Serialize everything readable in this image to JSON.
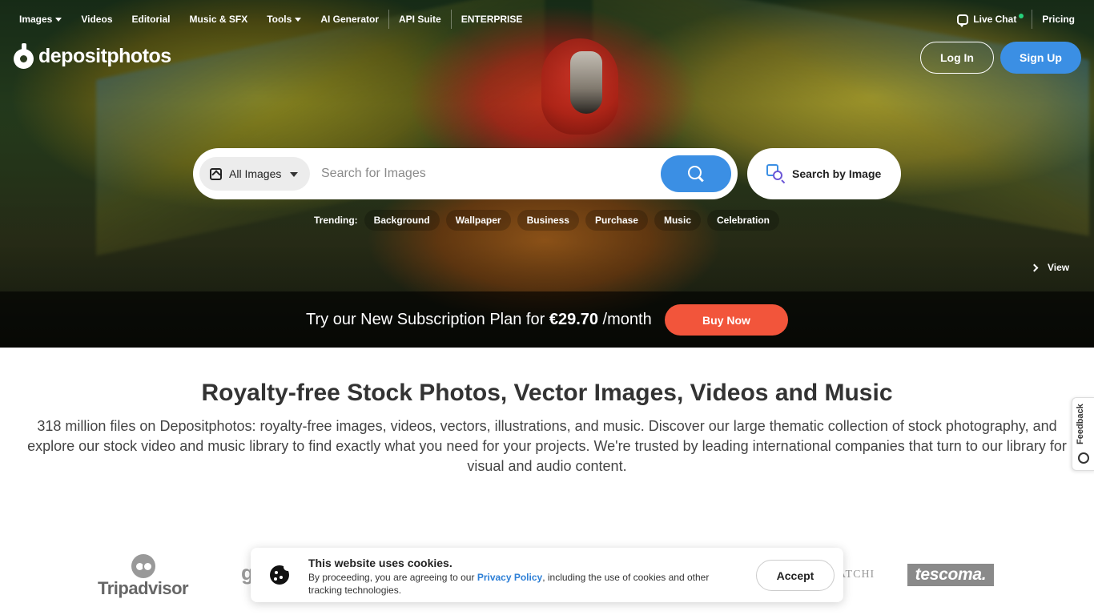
{
  "nav": {
    "left": [
      {
        "label": "Images",
        "dropdown": true
      },
      {
        "label": "Videos",
        "dropdown": false
      },
      {
        "label": "Editorial",
        "dropdown": false
      },
      {
        "label": "Music & SFX",
        "dropdown": false
      },
      {
        "label": "Tools",
        "dropdown": true
      },
      {
        "label": "AI Generator",
        "dropdown": false
      },
      {
        "label": "API Suite",
        "dropdown": false
      },
      {
        "label": "ENTERPRISE",
        "dropdown": false
      }
    ],
    "live_chat": "Live Chat",
    "pricing": "Pricing"
  },
  "logo": {
    "text": "depositphotos"
  },
  "auth": {
    "login": "Log In",
    "signup": "Sign Up"
  },
  "search": {
    "type_selected": "All Images",
    "placeholder": "Search for Images",
    "search_by_image": "Search by Image"
  },
  "trending": {
    "label": "Trending:",
    "items": [
      "Background",
      "Wallpaper",
      "Business",
      "Purchase",
      "Music",
      "Celebration"
    ]
  },
  "hero": {
    "view_label": "View"
  },
  "promo": {
    "text_before": "Try our New Subscription Plan for ",
    "price": "€29.70",
    "text_after": " /month",
    "button": "Buy Now"
  },
  "main": {
    "title": "Royalty-free Stock Photos, Vector Images, Videos and Music",
    "description": "318 million files on Depositphotos: royalty-free images, videos, vectors, illustrations, and music. Discover our large thematic collection of stock photography, and explore our stock video and music library to find exactly what you need for your projects. We're trusted by leading international companies that turn to our library for visual and audio content."
  },
  "feedback": {
    "label": "Feedback"
  },
  "brands": {
    "tripadvisor": "Tripadvisor",
    "partial_g": "g",
    "partial_atchi": "ATCHI",
    "tescoma": "tescoma."
  },
  "cookies": {
    "title": "This website uses cookies.",
    "text_before": "By proceeding, you are agreeing to our ",
    "link": "Privacy Policy",
    "text_after": ", including the use of cookies and other tracking technologies.",
    "accept": "Accept"
  },
  "colors": {
    "accent_blue": "#3b8fe4",
    "buy_orange": "#f2553b",
    "online_green": "#26d07c"
  }
}
